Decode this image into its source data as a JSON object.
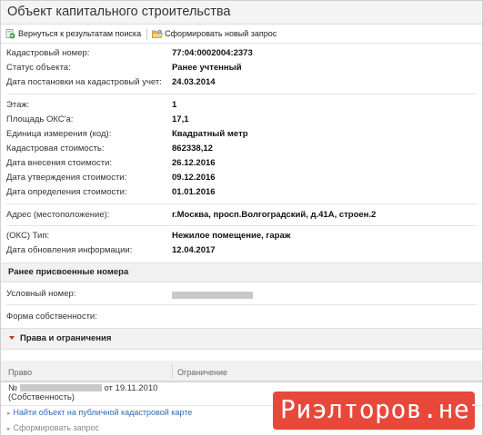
{
  "window": {
    "title": "Объект капитального строительства"
  },
  "toolbar": {
    "back_label": "Вернуться к результатам поиска",
    "new_request_label": "Сформировать новый запрос"
  },
  "info": {
    "cadastral_number": {
      "label": "Кадастровый номер:",
      "value": "77:04:0002004:2373"
    },
    "status": {
      "label": "Статус объекта:",
      "value": "Ранее учтенный"
    },
    "registration_date": {
      "label": "Дата постановки на кадастровый учет:",
      "value": "24.03.2014"
    },
    "floor": {
      "label": "Этаж:",
      "value": "1"
    },
    "area": {
      "label": "Площадь ОКС'a:",
      "value": "17,1"
    },
    "unit": {
      "label": "Единица измерения (код):",
      "value": "Квадратный метр"
    },
    "cadastral_value": {
      "label": "Кадастровая стоимость:",
      "value": "862338,12"
    },
    "value_entry_date": {
      "label": "Дата внесения стоимости:",
      "value": "26.12.2016"
    },
    "value_approval_date": {
      "label": "Дата утверждения стоимости:",
      "value": "09.12.2016"
    },
    "value_determination_date": {
      "label": "Дата определения стоимости:",
      "value": "01.01.2016"
    },
    "address": {
      "label": "Адрес (местоположение):",
      "value": "г.Москва, просп.Волгоградский, д.41А, строен.2"
    },
    "type": {
      "label": "(ОКС) Тип:",
      "value": "Нежилое помещение, гараж"
    },
    "info_update_date": {
      "label": "Дата обновления информации:",
      "value": "12.04.2017"
    }
  },
  "previous_numbers": {
    "header": "Ранее присвоенные номера",
    "conditional_number_label": "Условный номер:",
    "ownership_label": "Форма собственности:"
  },
  "rights": {
    "header": "Права и ограничения",
    "col_right": "Право",
    "col_restriction": "Ограничение",
    "entry_prefix": "№",
    "entry_date": "от 19.11.2010",
    "entry_type": "(Собственность)"
  },
  "links": {
    "public_map": "Найти объект на публичной кадастровой карте",
    "make_request": "Сформировать запрос"
  },
  "watermark": {
    "text": "Риэлторов.нет"
  },
  "colors": {
    "link": "#2a6bb5",
    "accent_red": "#c0392b",
    "watermark_bg": "#e8483a"
  }
}
